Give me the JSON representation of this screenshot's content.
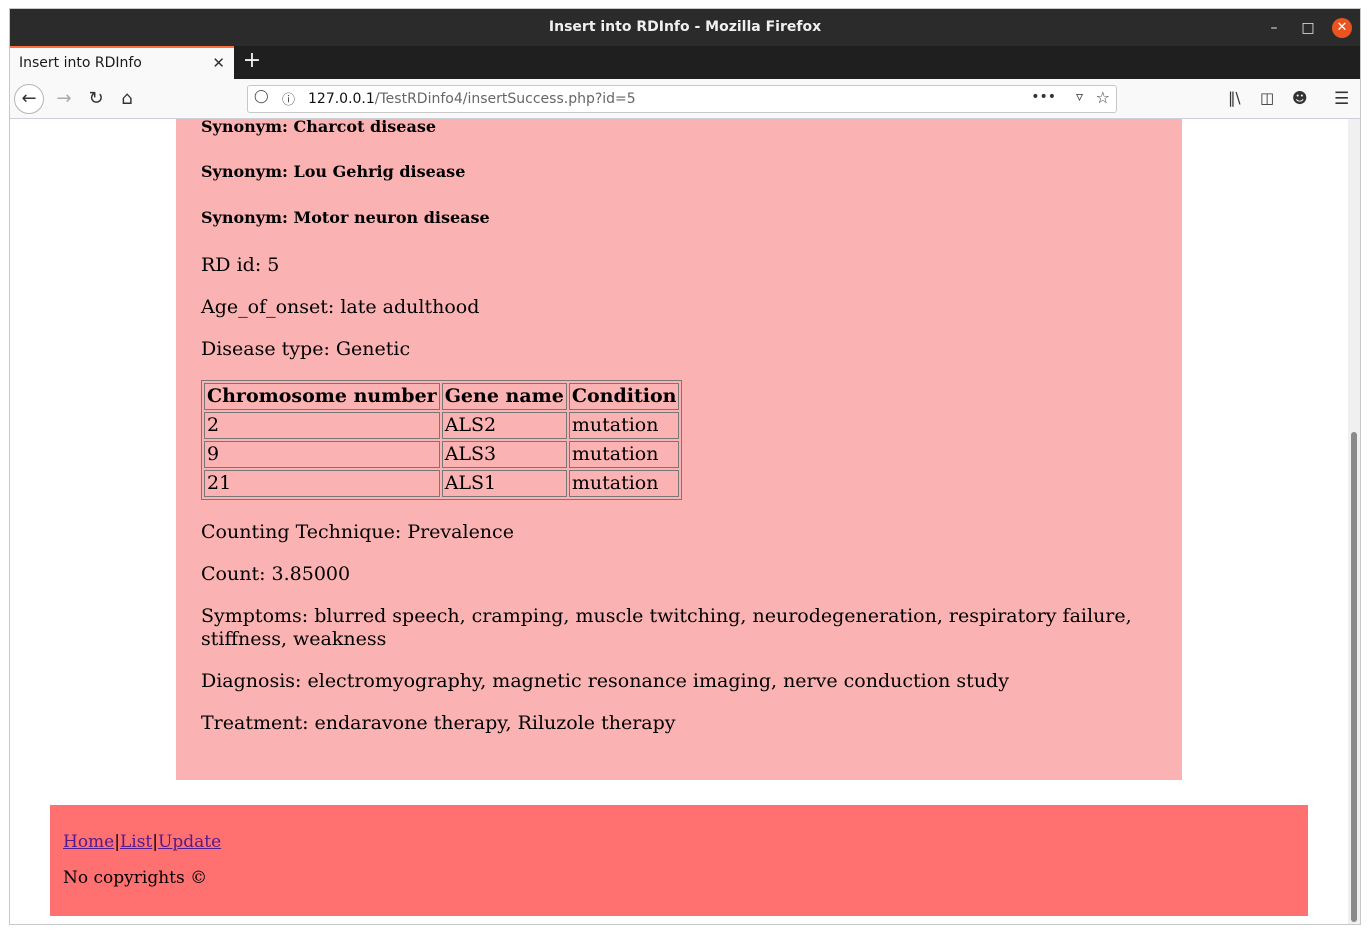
{
  "window": {
    "title": "Insert into RDInfo - Mozilla Firefox",
    "minimize_icon": "minimize-icon",
    "maximize_icon": "maximize-icon",
    "close_icon": "close-icon"
  },
  "tabs": [
    {
      "label": "Insert into RDInfo",
      "active": true
    }
  ],
  "toolbar": {
    "url_host": "127.0.0.1",
    "url_path": "/TestRDinfo4/insertSuccess.php?id=5",
    "icons": [
      "back-icon",
      "forward-icon",
      "reload-icon",
      "home-icon",
      "shield-icon",
      "info-icon",
      "more-icon",
      "pocket-icon",
      "bookmark-star-icon",
      "library-icon",
      "sidebar-icon",
      "account-icon",
      "menu-icon"
    ]
  },
  "page": {
    "synonyms": [
      "Synonym: Charcot disease",
      "Synonym: Lou Gehrig disease",
      "Synonym: Motor neuron disease"
    ],
    "rd_id": "RD id: 5",
    "age_of_onset": "Age_of_onset: late adulthood",
    "disease_type": "Disease type: Genetic",
    "gene_table": {
      "headers": [
        "Chromosome number",
        "Gene name",
        "Condition"
      ],
      "rows": [
        [
          "2",
          "ALS2",
          "mutation"
        ],
        [
          "9",
          "ALS3",
          "mutation"
        ],
        [
          "21",
          "ALS1",
          "mutation"
        ]
      ]
    },
    "counting_technique": "Counting Technique: Prevalence",
    "count": "Count: 3.85000",
    "symptoms": "Symptoms: blurred speech, cramping, muscle twitching, neurodegeneration, respiratory failure, stiffness, weakness",
    "diagnosis": "Diagnosis: electromyography, magnetic resonance imaging, nerve conduction study",
    "treatment": "Treatment: endaravone therapy, Riluzole therapy"
  },
  "footer": {
    "links": [
      "Home",
      "List",
      "Update"
    ],
    "separator": "|",
    "copyright": "No copyrights ©"
  },
  "colors": {
    "content_bg": "#fbb2b2",
    "footer_bg": "#ff7070",
    "link": "#551a8b",
    "tab_accent": "#ff6f3d"
  }
}
